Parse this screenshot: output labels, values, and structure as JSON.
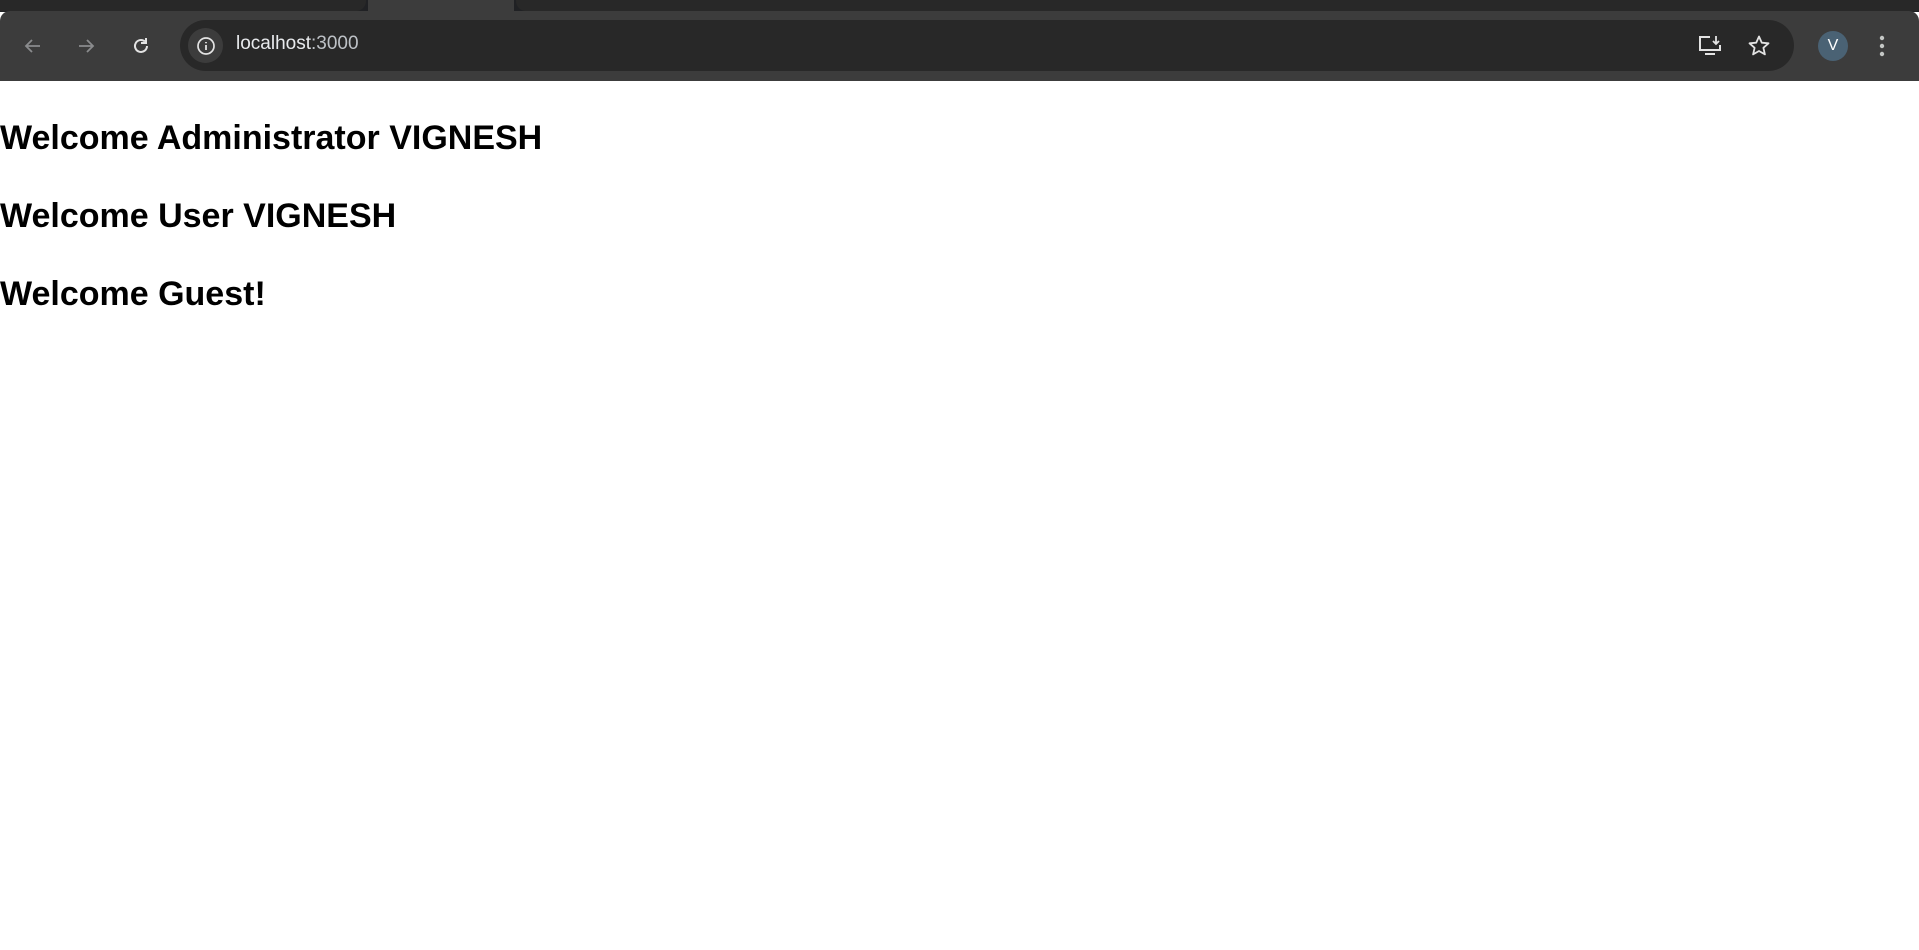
{
  "browser": {
    "url_host": "localhost",
    "url_port": ":3000",
    "profile_initial": "V"
  },
  "page": {
    "headings": [
      "Welcome Administrator VIGNESH",
      "Welcome User VIGNESH",
      "Welcome Guest!"
    ]
  }
}
